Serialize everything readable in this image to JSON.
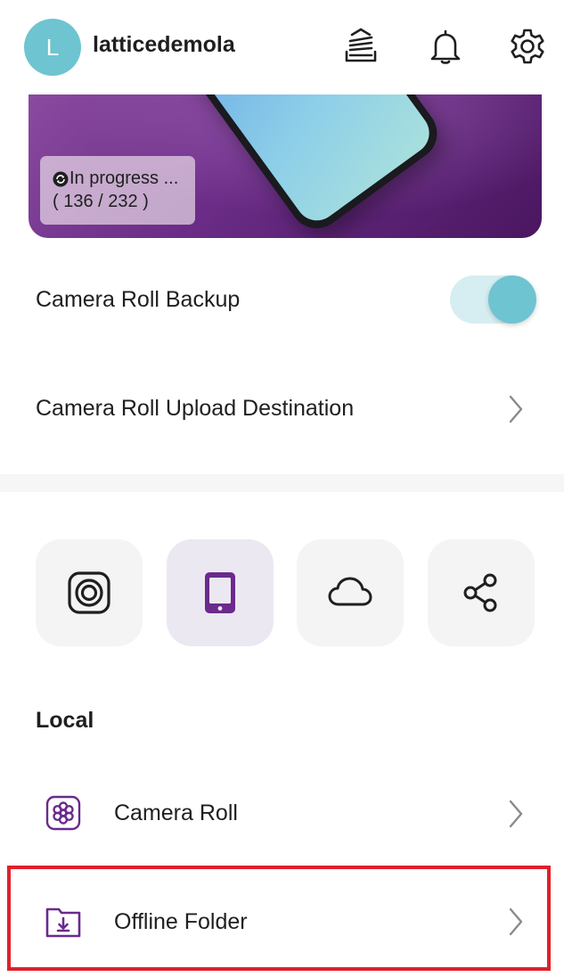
{
  "header": {
    "avatar_initial": "L",
    "username": "latticedemola",
    "icons": [
      "upload-stack-icon",
      "bell-icon",
      "gear-icon"
    ]
  },
  "banner": {
    "status_text": "In progress ...",
    "progress_text": "( 136 / 232 )",
    "progress_done": 136,
    "progress_total": 232
  },
  "settings": {
    "camera_roll_backup_label": "Camera Roll Backup",
    "camera_roll_backup_enabled": true,
    "upload_destination_label": "Camera Roll Upload Destination"
  },
  "tiles": [
    {
      "icon": "camera-lens-icon",
      "selected": false
    },
    {
      "icon": "tablet-icon",
      "selected": true
    },
    {
      "icon": "cloud-icon",
      "selected": false
    },
    {
      "icon": "share-icon",
      "selected": false
    }
  ],
  "local": {
    "title": "Local",
    "items": [
      {
        "label": "Camera Roll",
        "icon": "flower-icon"
      },
      {
        "label": "Offline Folder",
        "icon": "download-folder-icon"
      }
    ]
  },
  "colors": {
    "accent_teal": "#6ec4d1",
    "accent_purple": "#6b2a8c",
    "highlight_red": "#e0202a"
  }
}
